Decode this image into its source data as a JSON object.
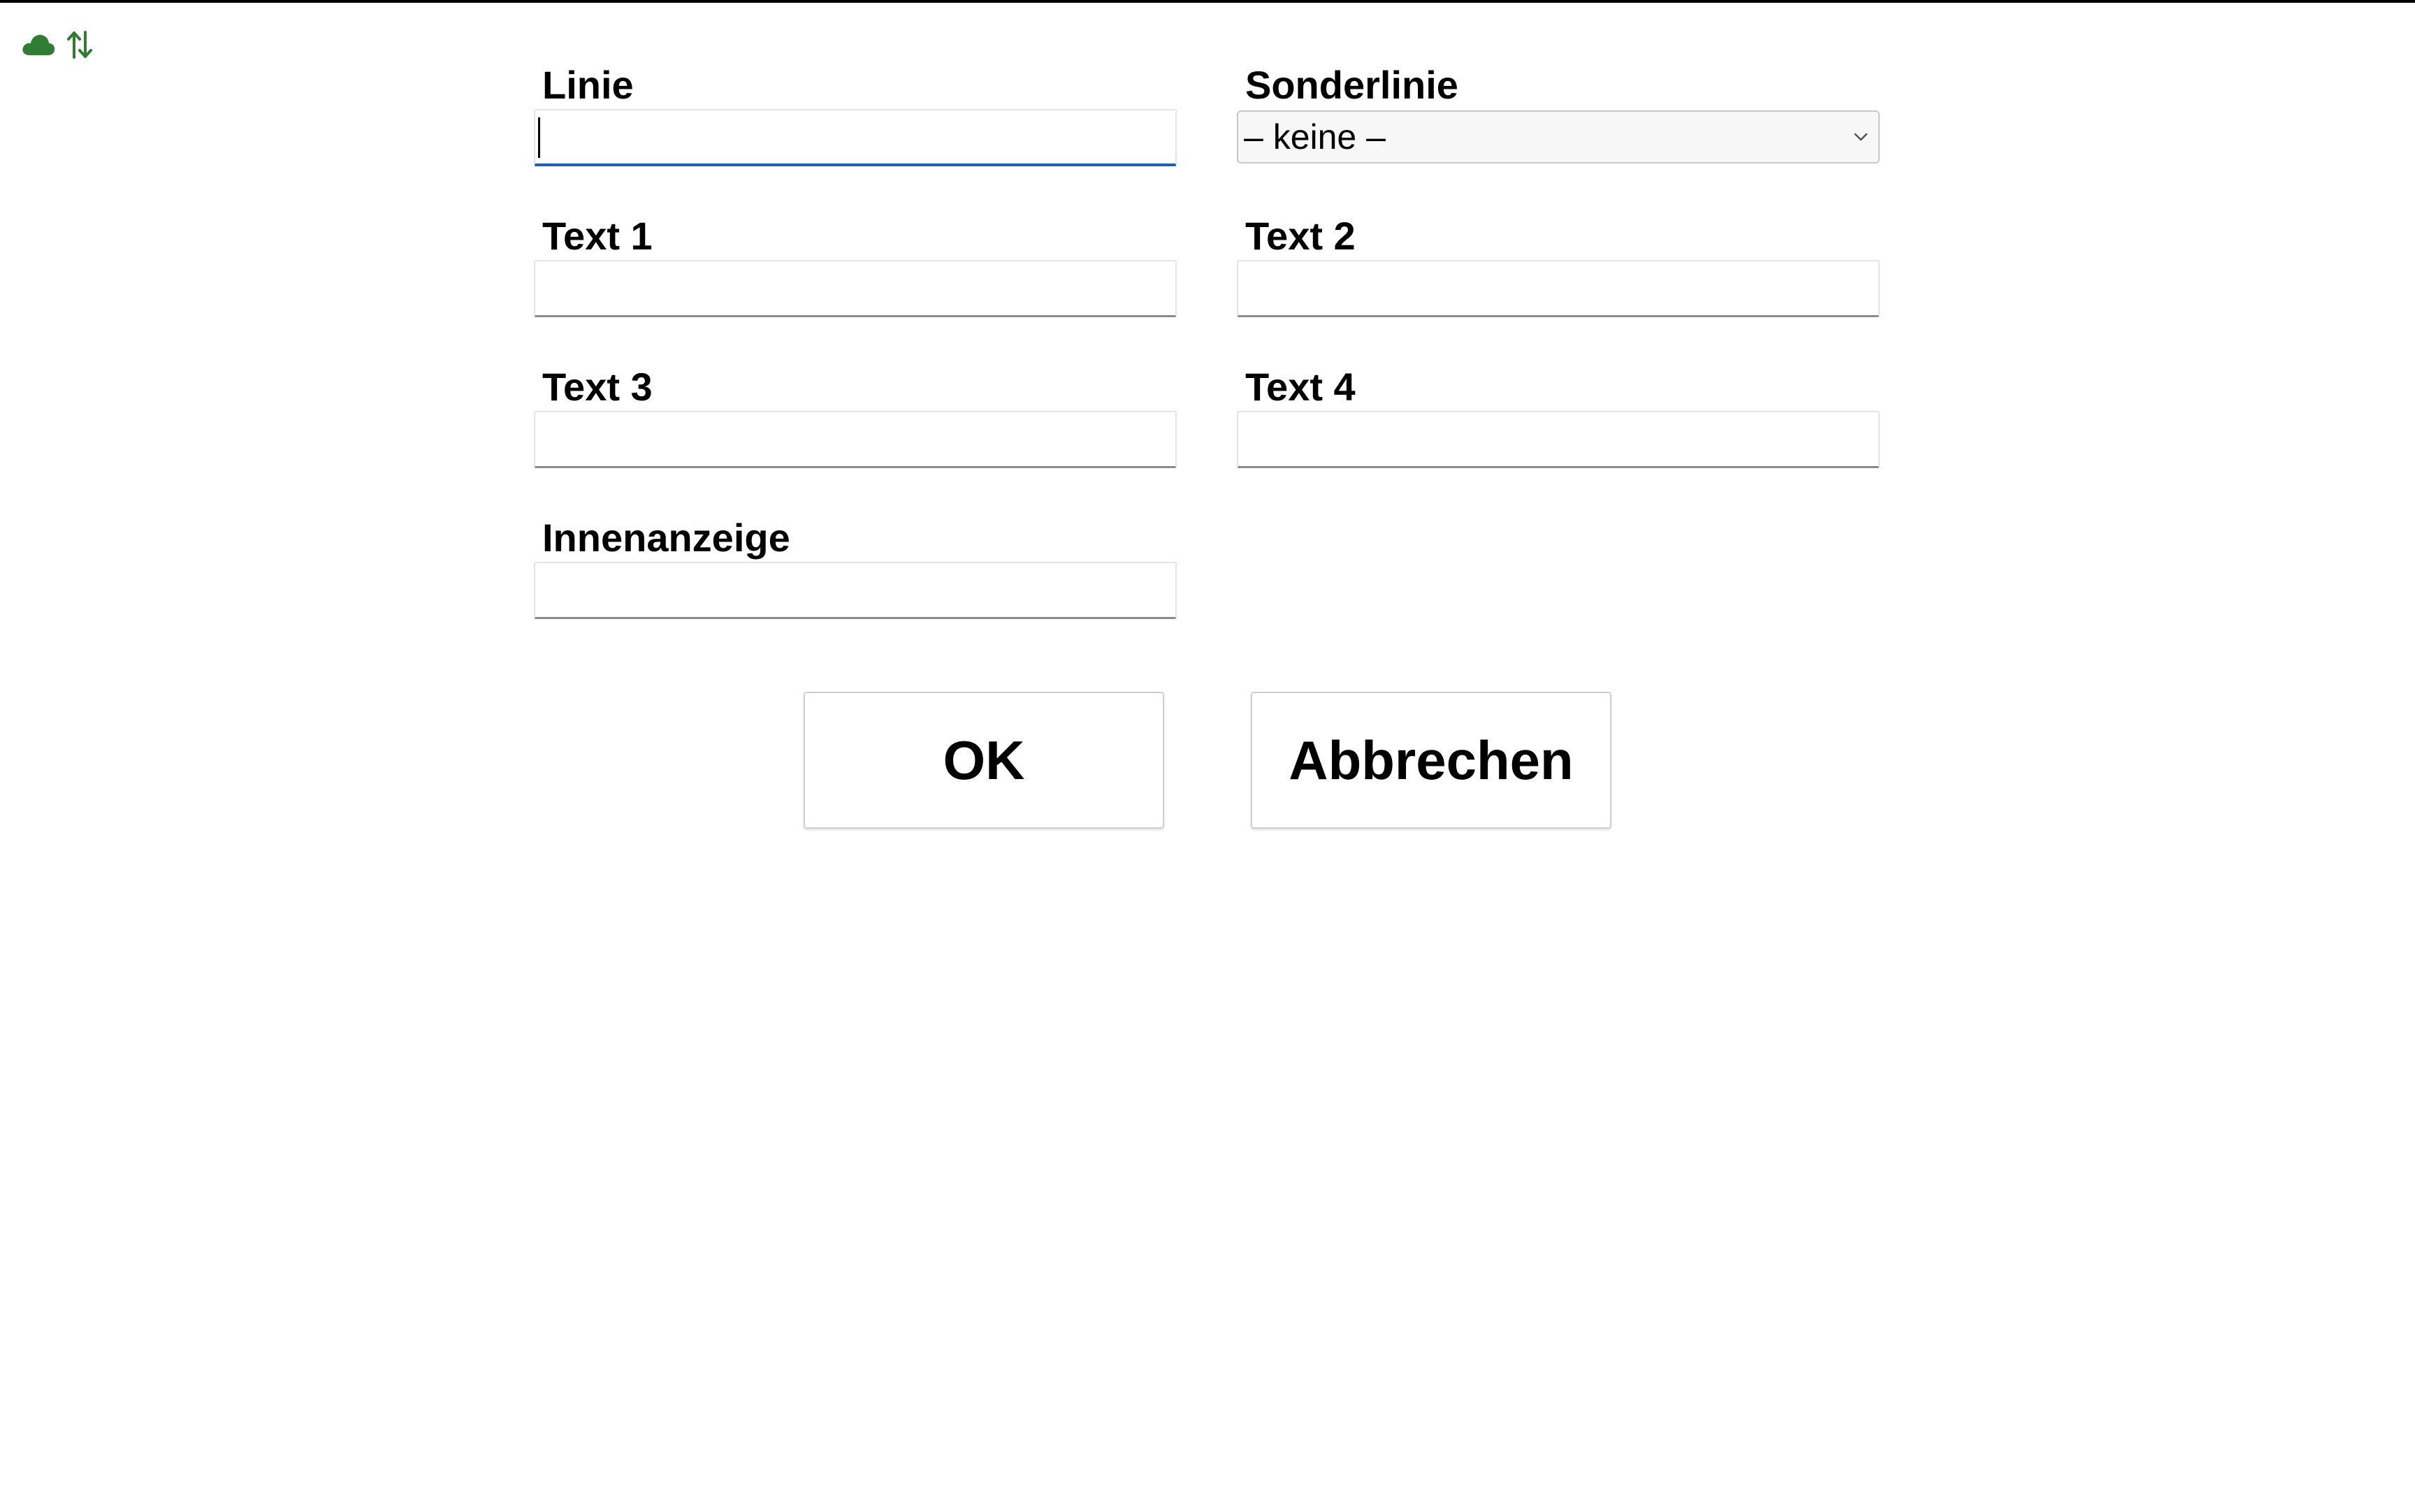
{
  "status": {
    "cloud_icon": "cloud-icon",
    "sync_icon": "sync-arrows-icon",
    "accent_color": "#2e7d32"
  },
  "form": {
    "linie": {
      "label": "Linie",
      "value": ""
    },
    "sonderlinie": {
      "label": "Sonderlinie",
      "selected": "– keine –"
    },
    "text1": {
      "label": "Text 1",
      "value": ""
    },
    "text2": {
      "label": "Text 2",
      "value": ""
    },
    "text3": {
      "label": "Text 3",
      "value": ""
    },
    "text4": {
      "label": "Text 4",
      "value": ""
    },
    "innenanzeige": {
      "label": "Innenanzeige",
      "value": ""
    }
  },
  "buttons": {
    "ok_label": "OK",
    "cancel_label": "Abbrechen"
  }
}
